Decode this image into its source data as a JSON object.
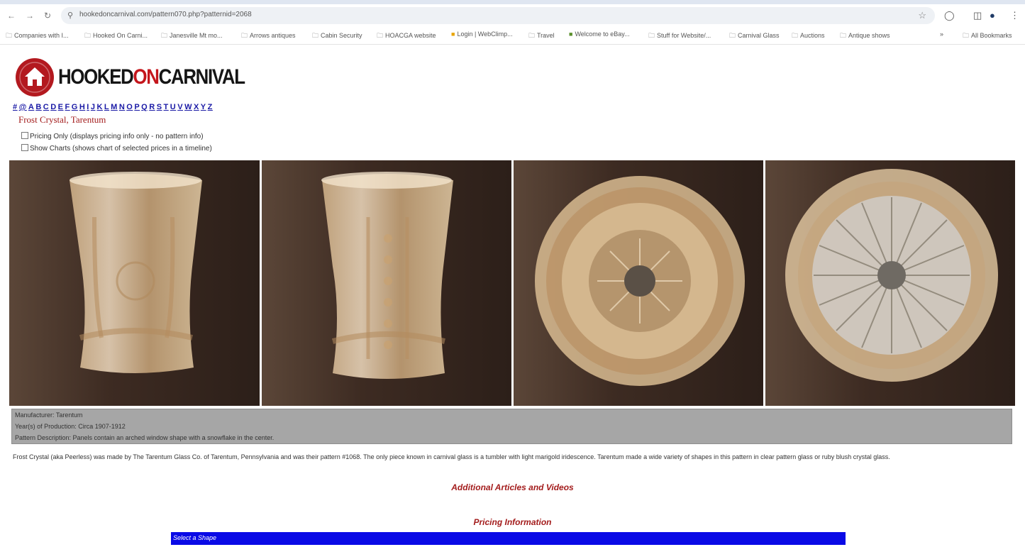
{
  "browser": {
    "url": "hookedoncarnival.com/pattern070.php?patternid=2068",
    "nav_back": "←",
    "nav_forward": "→",
    "nav_reload": "↻",
    "site_icon": "⚲",
    "star_icon": "☆",
    "bookmarks": [
      "Companies with I...",
      "Hooked On Carni...",
      "Janesville Mt mo...",
      "Arrows antiques",
      "Cabin Security",
      "HOACGA website",
      "Login | WebClimp...",
      "Travel",
      "Welcome to eBay...",
      "Stuff for Website/...",
      "Carnival Glass",
      "Auctions",
      "Antique shows"
    ],
    "bookmarks_more": "»",
    "all_bookmarks": "All Bookmarks"
  },
  "page": {
    "logo_part1": "HOOKED",
    "logo_part2": "ON",
    "logo_part3": "CARNIVAL",
    "alphabet": [
      "#",
      "@",
      "A",
      "B",
      "C",
      "D",
      "E",
      "F",
      "G",
      "H",
      "I",
      "J",
      "K",
      "L",
      "M",
      "N",
      "O",
      "P",
      "Q",
      "R",
      "S",
      "T",
      "U",
      "V",
      "W",
      "X",
      "Y",
      "Z"
    ],
    "pattern_title": "Frost Crystal, Tarentum",
    "option_pricing": "Pricing Only (displays pricing info only - no pattern info)",
    "option_charts": "Show Charts (shows chart of selected prices in a timeline)",
    "info_manufacturer": "Manufacturer: Tarentum",
    "info_period": "Year(s) of Production: Circa 1907-1912",
    "info_pattern": "Pattern Description: Panels contain an arched window shape with a snowflake in the center.",
    "description": "Frost Crystal (aka Peerless) was made by The Tarentum Glass Co. of Tarentum, Pennsylvania and was their pattern #1068. The only piece known in carnival glass is a tumbler with light marigold iridescence. Tarentum made a wide variety of shapes in this pattern in clear pattern glass or ruby blush crystal glass.",
    "additional_articles": "Additional Articles and Videos",
    "pricing_information": "Pricing Information",
    "select_shape": "Select a Shape"
  },
  "colors": {
    "brand_red": "#b3191f",
    "link_blue": "#1a1aa6",
    "title_red": "#a31c1c",
    "info_gray": "#a6a6a6",
    "select_blue": "#0a0ae6"
  }
}
